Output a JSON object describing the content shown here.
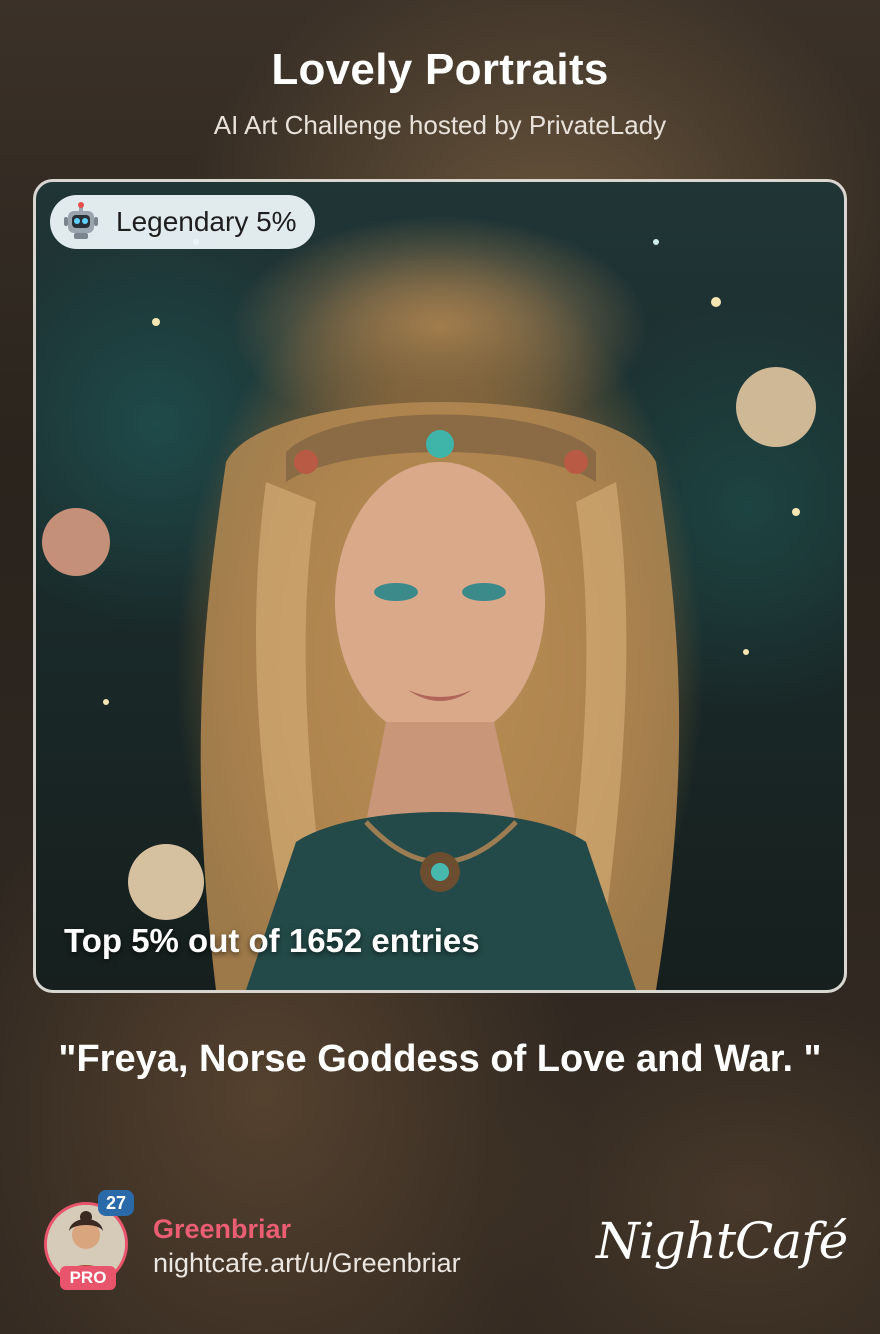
{
  "header": {
    "title": "Lovely Portraits",
    "subtitle": "AI Art Challenge hosted by PrivateLady"
  },
  "card": {
    "badge_icon": "robot-icon",
    "badge_label": "Legendary 5%",
    "caption": "Top 5% out of 1652 entries"
  },
  "prompt_text": "\"Freya, Norse Goddess of Love and War. \"",
  "user": {
    "level": "27",
    "pro_label": "PRO",
    "name": "Greenbriar",
    "url": "nightcafe.art/u/Greenbriar"
  },
  "brand": {
    "logo_text": "NightCafé"
  },
  "colors": {
    "accent_pink": "#e8546b",
    "level_blue": "#2b6aa8",
    "badge_bg": "#ecf4f8"
  }
}
